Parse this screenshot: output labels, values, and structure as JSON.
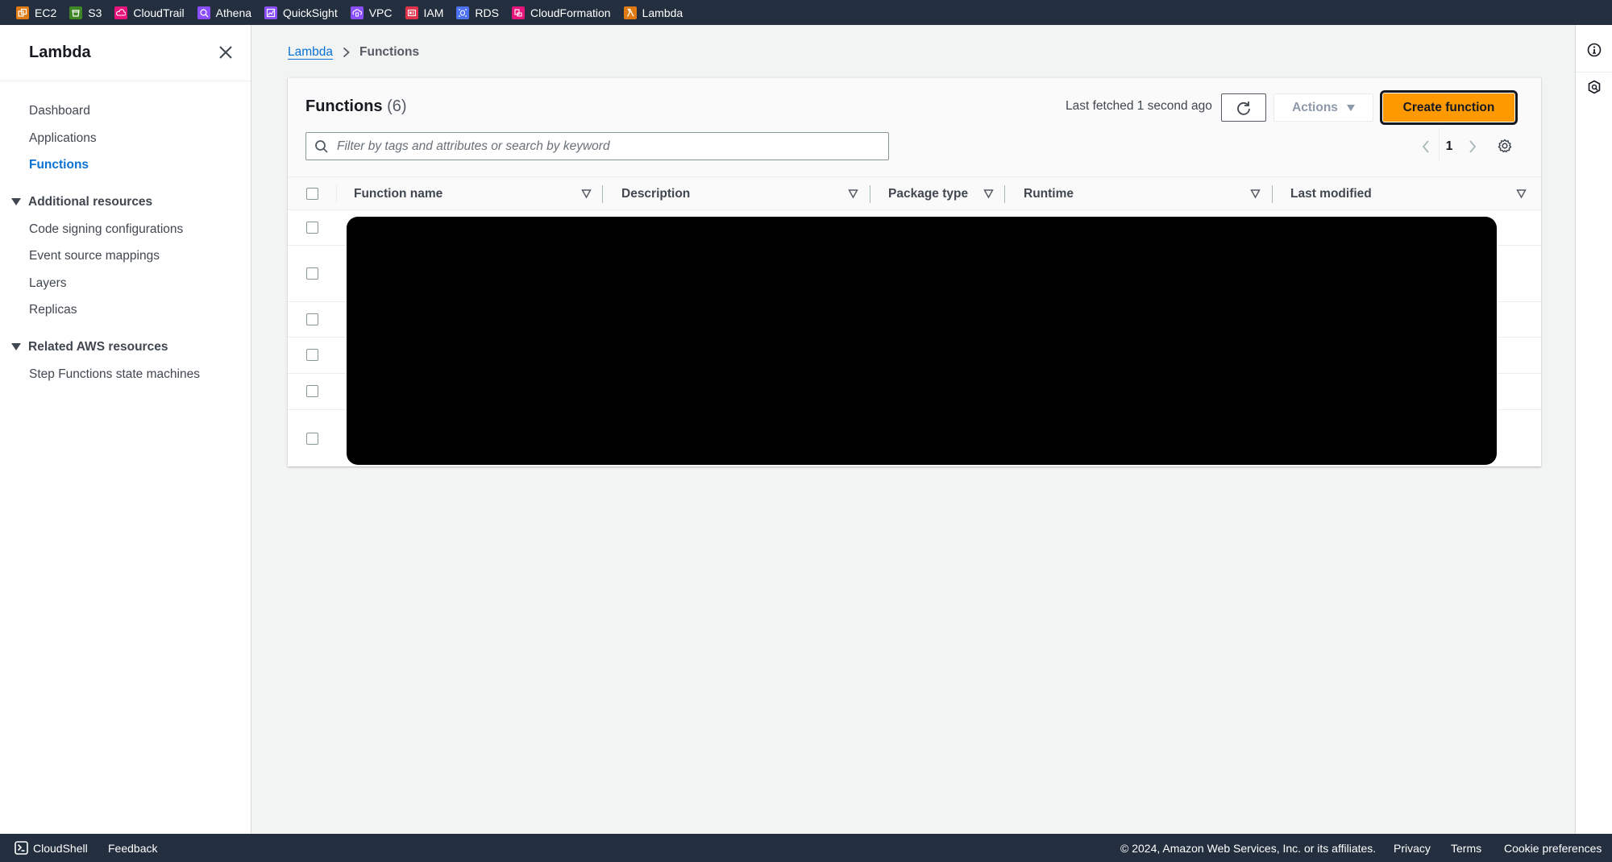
{
  "topbar": {
    "services": [
      {
        "label": "EC2",
        "icon": "ec2-icon",
        "color": "#e07b14"
      },
      {
        "label": "S3",
        "icon": "s3-icon",
        "color": "#3f8624"
      },
      {
        "label": "CloudTrail",
        "icon": "cloudtrail-icon",
        "color": "#e7157b"
      },
      {
        "label": "Athena",
        "icon": "athena-icon",
        "color": "#8c4fff"
      },
      {
        "label": "QuickSight",
        "icon": "quicksight-icon",
        "color": "#8c4fff"
      },
      {
        "label": "VPC",
        "icon": "vpc-icon",
        "color": "#8c4fff"
      },
      {
        "label": "IAM",
        "icon": "iam-icon",
        "color": "#dd344c"
      },
      {
        "label": "RDS",
        "icon": "rds-icon",
        "color": "#4d72f3"
      },
      {
        "label": "CloudFormation",
        "icon": "cloudformation-icon",
        "color": "#e7157b"
      },
      {
        "label": "Lambda",
        "icon": "lambda-icon",
        "color": "#e07b14"
      }
    ]
  },
  "sidenav": {
    "title": "Lambda",
    "close_icon": "close-icon",
    "items": [
      {
        "label": "Dashboard",
        "active": false
      },
      {
        "label": "Applications",
        "active": false
      },
      {
        "label": "Functions",
        "active": true
      }
    ],
    "sections": [
      {
        "label": "Additional resources",
        "expanded": true,
        "items": [
          "Code signing configurations",
          "Event source mappings",
          "Layers",
          "Replicas"
        ]
      },
      {
        "label": "Related AWS resources",
        "expanded": true,
        "items": [
          "Step Functions state machines"
        ]
      }
    ]
  },
  "breadcrumb": {
    "items": [
      {
        "label": "Lambda",
        "link": true
      },
      {
        "label": "Functions",
        "link": false
      }
    ]
  },
  "panel": {
    "title": "Functions",
    "count": "(6)",
    "last_fetched": "Last fetched 1 second ago",
    "actions_label": "Actions",
    "actions_disabled": true,
    "create_label": "Create function",
    "search_placeholder": "Filter by tags and attributes or search by keyword",
    "search_value": "",
    "page": "1",
    "accent_color": "#ff9900"
  },
  "table": {
    "columns": [
      "Function name",
      "Description",
      "Package type",
      "Runtime",
      "Last modified"
    ],
    "row_count": 6,
    "rows_redacted": true
  },
  "rightrail": {
    "icons": [
      "info-icon",
      "feedback-hexagon-icon"
    ]
  },
  "footer": {
    "cloudshell": "CloudShell",
    "feedback": "Feedback",
    "copyright": "© 2024, Amazon Web Services, Inc. or its affiliates.",
    "privacy": "Privacy",
    "terms": "Terms",
    "cookies": "Cookie preferences"
  }
}
